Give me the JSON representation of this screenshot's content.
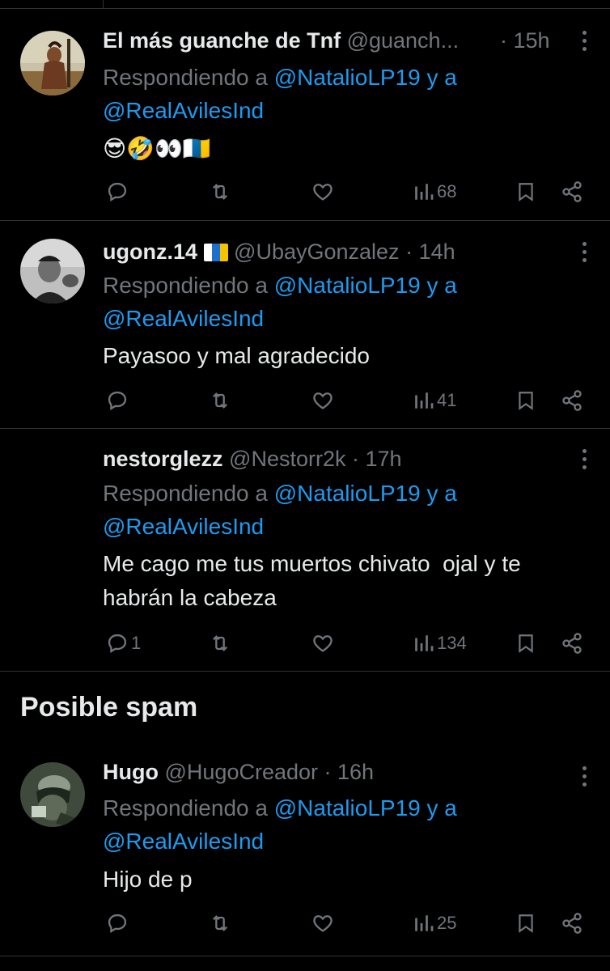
{
  "tweets": [
    {
      "name": "El más guanche de Tnf",
      "handle": "@guanch...",
      "dot": " · ",
      "time": "15h",
      "replying_prefix": "Respondiendo a ",
      "mention1": "@NatalioLP19",
      "and": " y a",
      "mention2": "@RealAvilesInd",
      "text": "😎🤣👀🇮🇨",
      "replies": "",
      "views": "68"
    },
    {
      "name": "ugonz.14",
      "handle": "@UbayGonzalez",
      "dot": " · ",
      "time": "14h",
      "replying_prefix": "Respondiendo a ",
      "mention1": "@NatalioLP19",
      "and": " y a",
      "mention2": "@RealAvilesInd",
      "text": "Payasoo y mal agradecido",
      "replies": "",
      "views": "41"
    },
    {
      "name": "nestorglezz",
      "handle": "@Nestorr2k",
      "dot": " · ",
      "time": "17h",
      "replying_prefix": "Respondiendo a ",
      "mention1": "@NatalioLP19",
      "and": " y a",
      "mention2": "@RealAvilesInd",
      "text": "Me cago me tus muertos chivato  ojal y te habrán la cabeza",
      "replies": "1",
      "views": "134"
    },
    {
      "name": "Hugo",
      "handle": "@HugoCreador",
      "dot": " · ",
      "time": "16h",
      "replying_prefix": "Respondiendo a ",
      "mention1": "@NatalioLP19",
      "and": " y a",
      "mention2": "@RealAvilesInd",
      "text": "Hijo de p",
      "replies": "",
      "views": "25"
    }
  ],
  "spam_section": {
    "title": "Posible spam"
  },
  "colors": {
    "background": "#000000",
    "text": "#e7e9ea",
    "muted": "#71767b",
    "link": "#1d9bf0",
    "divider": "#2f3336"
  }
}
